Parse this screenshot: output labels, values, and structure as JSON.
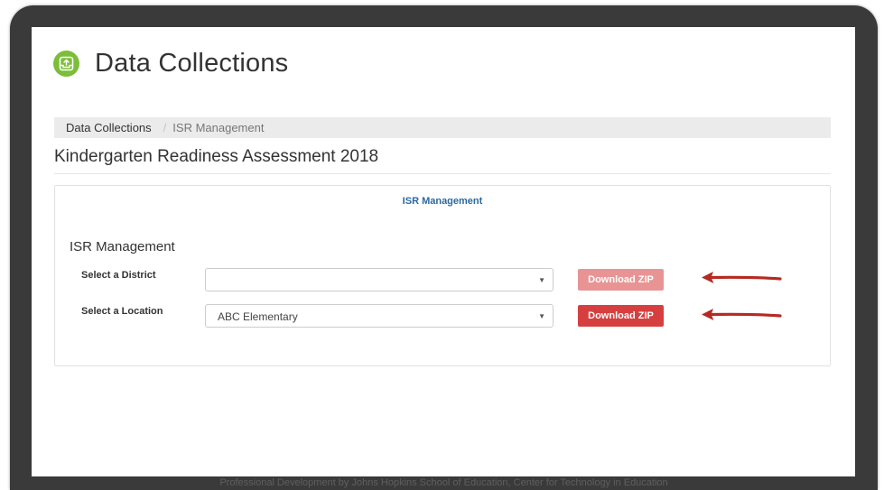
{
  "header": {
    "title": "Data Collections",
    "icon": "upload-tray-icon",
    "icon_color": "#7cbd3a"
  },
  "breadcrumb": {
    "root": "Data Collections",
    "separator": "/",
    "current": "ISR Management"
  },
  "assessment_title": "Kindergarten Readiness Assessment 2018",
  "panel": {
    "heading": "ISR Management",
    "section_title": "ISR Management",
    "rows": [
      {
        "label": "Select a District",
        "selected_value": "",
        "button_label": "Download ZIP",
        "button_state": "disabled"
      },
      {
        "label": "Select a Location",
        "selected_value": "ABC Elementary",
        "button_label": "Download ZIP",
        "button_state": "enabled"
      }
    ]
  },
  "footer": {
    "text": "Professional Development by Johns Hopkins School of Education, Center for Technology in Education"
  },
  "colors": {
    "accent_link": "#2a6aa0",
    "button_active": "#d63f3f",
    "button_disabled": "#e89494",
    "annotation_arrow": "#b52a22",
    "frame": "#3a3a3a"
  }
}
